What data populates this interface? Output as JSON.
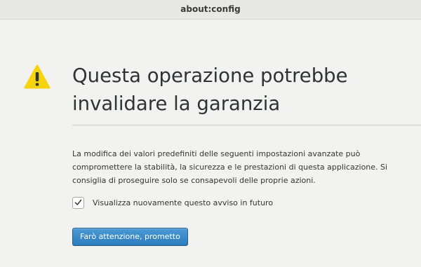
{
  "window": {
    "title": "about:config"
  },
  "warning": {
    "icon": "warning-icon",
    "icon_color": "#f5d40f",
    "title": "Questa operazione potrebbe invalidare la garanzia",
    "description": "La modifica dei valori predefiniti delle seguenti impostazioni avanzate può compromettere la stabilità, la sicurezza e le prestazioni di questa applicazione. Si consiglia di proseguire solo se consapevoli delle proprie azioni."
  },
  "checkbox": {
    "checked": true,
    "label": "Visualizza nuovamente questo avviso in futuro"
  },
  "confirm_button": {
    "label": "Farò attenzione, prometto",
    "color": "#2f80c1"
  }
}
